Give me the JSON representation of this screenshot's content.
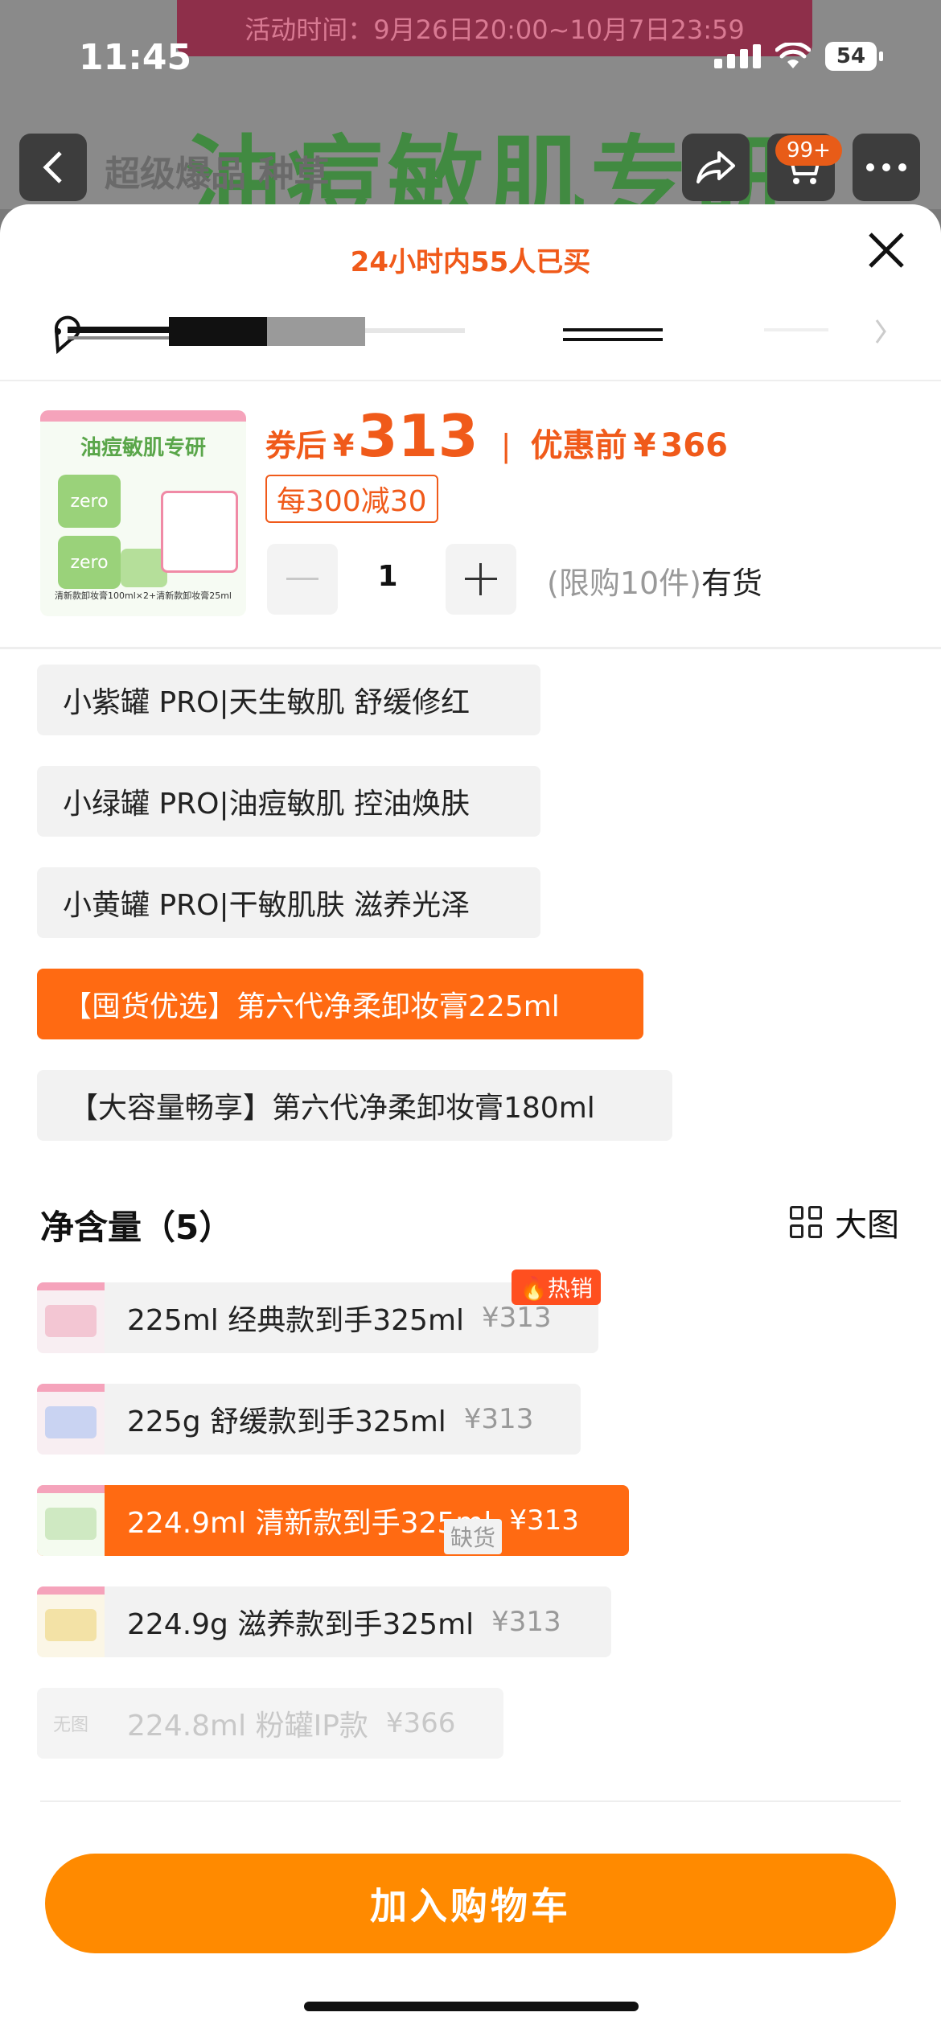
{
  "background": {
    "activity_time": "活动时间：9月26日20:00~10月7日23:59",
    "headline": "油痘敏肌专研",
    "subtitle": "超级爆品 种草",
    "cart_badge": "99+"
  },
  "status_bar": {
    "time": "11:45",
    "battery": "54"
  },
  "sheet": {
    "sold_notice": "24小时内55人已买",
    "close_icon": "close-icon"
  },
  "product": {
    "thumb_banner": "油痘敏肌专研",
    "thumb_brand": "zero",
    "thumb_caption": "清新款卸妆膏100ml×2+清新款卸妆膏25ml",
    "coupon_label": "券后",
    "currency": "¥",
    "coupon_price": "313",
    "before_label": "优惠前",
    "before_price": "366",
    "promo": "每300减30",
    "quantity": "1",
    "limit": "(限购10件)",
    "stock": "有货"
  },
  "variants": [
    {
      "label": "小紫罐 PRO|天生敏肌 舒缓修红",
      "selected": false
    },
    {
      "label": "小绿罐 PRO|油痘敏肌 控油焕肤",
      "selected": false
    },
    {
      "label": "小黄罐 PRO|干敏肌肤 滋养光泽",
      "selected": false
    },
    {
      "label": "【囤货优选】第六代净柔卸妆膏225ml",
      "selected": true
    },
    {
      "label": "【大容量畅享】第六代净柔卸妆膏180ml",
      "selected": false
    }
  ],
  "volume": {
    "title": "净含量（5）",
    "big_view": "大图",
    "hot_badge": "热销",
    "out_of_stock": "缺货",
    "no_image": "无图",
    "options": [
      {
        "label": "225ml 经典款到手325ml",
        "price": "¥313",
        "state": "normal",
        "color": "#f3c6d3"
      },
      {
        "label": "225g 舒缓款到手325ml",
        "price": "¥313",
        "state": "normal",
        "color": "#c9d3f2"
      },
      {
        "label": "224.9ml 清新款到手325ml",
        "price": "¥313",
        "state": "selected",
        "color": "#cfe9c2"
      },
      {
        "label": "224.9g 滋养款到手325ml",
        "price": "¥313",
        "state": "normal",
        "color": "#f3e2a6"
      },
      {
        "label": "224.8ml 粉罐IP款",
        "price": "¥366",
        "state": "disabled",
        "color": "#f2f2f2"
      }
    ]
  },
  "footer": {
    "add_to_cart": "加入购物车"
  },
  "colors": {
    "accent": "#ff6a12",
    "price": "#f05a1a",
    "cta": "#ff8a00"
  }
}
